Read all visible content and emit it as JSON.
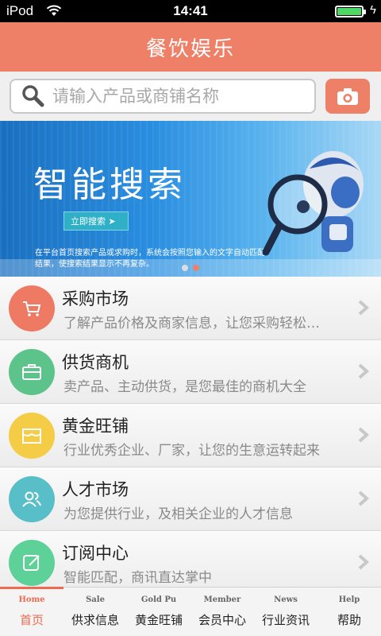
{
  "status_bar": {
    "carrier": "iPod",
    "time": "14:41",
    "battery_level": 1.0,
    "colors": {
      "battery": "#4cd964"
    }
  },
  "header": {
    "title": "餐饮娱乐",
    "color": "#ef8068"
  },
  "search": {
    "placeholder": "请输入产品或商铺名称",
    "search_icon": "search-icon",
    "camera_icon": "camera-icon"
  },
  "banner": {
    "title": "智能搜索",
    "cta": "立即搜索 ➤",
    "description": "在平台首页搜索产品或求购时，系统会按照您输入的文字自动匹配结果，使搜索结果显示不再复杂。",
    "active_slide": 2,
    "slide_count": 2
  },
  "list": [
    {
      "title": "采购市场",
      "subtitle": "了解产品价格及商家信息，让您采购轻松…",
      "icon": "cart-icon",
      "color": "#ef7a64"
    },
    {
      "title": "供货商机",
      "subtitle": "卖产品、主动供货，是您最佳的商机大全",
      "icon": "briefcase-icon",
      "color": "#5cc48a"
    },
    {
      "title": "黄金旺铺",
      "subtitle": "行业优秀企业、厂家，让您的生意运转起来",
      "icon": "store-icon",
      "color": "#f5cc45"
    },
    {
      "title": "人才市场",
      "subtitle": "为您提供行业，及相关企业的人才信息",
      "icon": "people-icon",
      "color": "#58bfc9"
    },
    {
      "title": "订阅中心",
      "subtitle": "智能匹配，商讯直达掌中",
      "icon": "edit-icon",
      "color": "#5ed199"
    }
  ],
  "tabs": [
    {
      "en": "Home",
      "cn": "首页",
      "active": true
    },
    {
      "en": "Sale",
      "cn": "供求信息",
      "active": false
    },
    {
      "en": "Gold Pu",
      "cn": "黄金旺铺",
      "active": false
    },
    {
      "en": "Member",
      "cn": "会员中心",
      "active": false
    },
    {
      "en": "News",
      "cn": "行业资讯",
      "active": false
    },
    {
      "en": "Help",
      "cn": "帮助",
      "active": false
    }
  ]
}
